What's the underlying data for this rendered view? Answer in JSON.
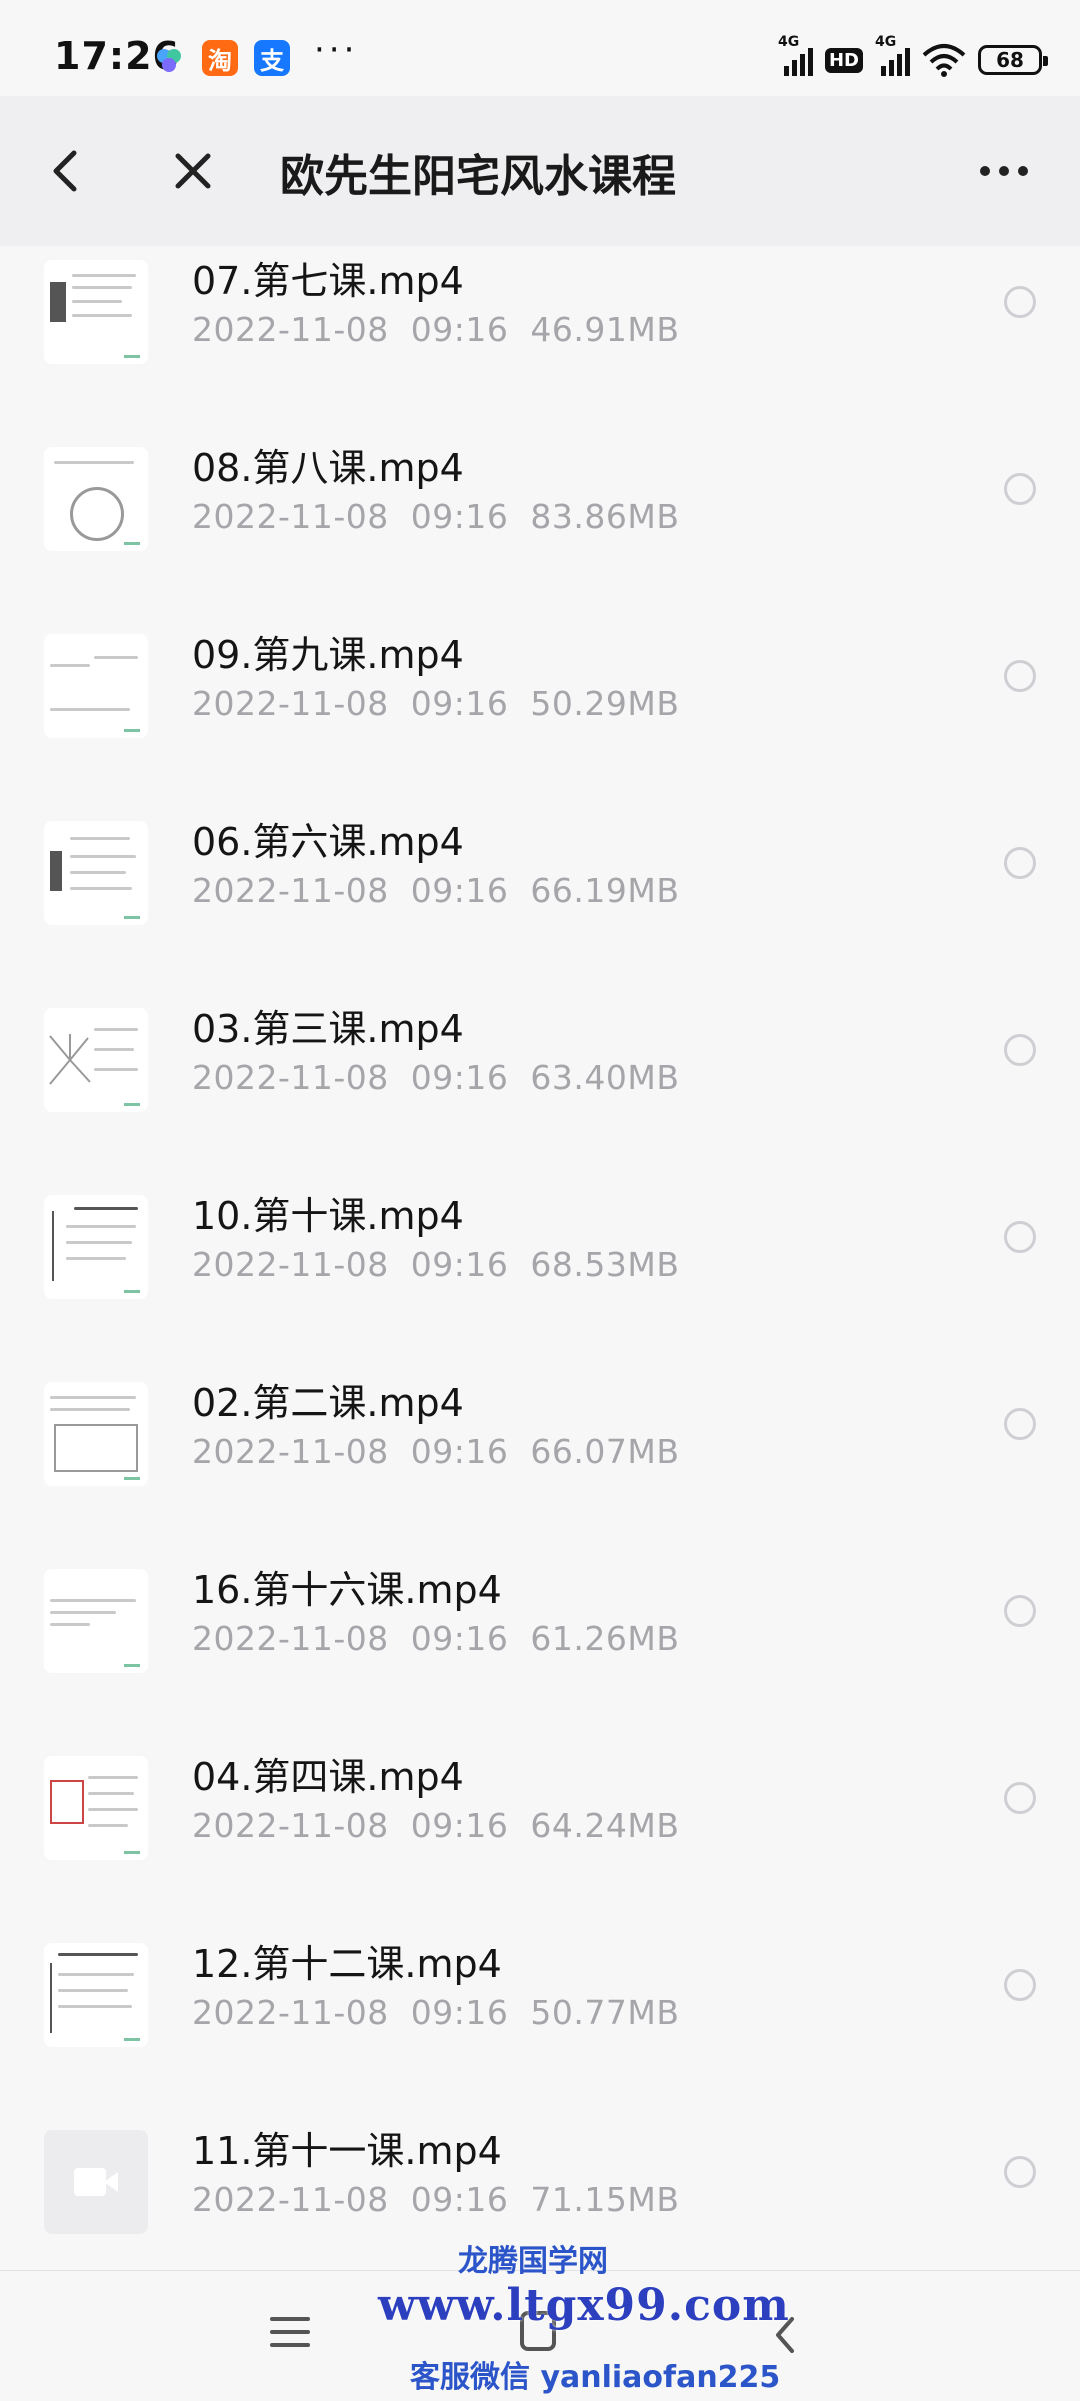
{
  "status_bar": {
    "time": "17:26",
    "icons": [
      "flower-app-icon",
      "taobao-icon",
      "alipay-icon"
    ],
    "tao_char": "淘",
    "pay_char": "支",
    "more": "···",
    "net1": "4G",
    "hd": "HD",
    "net2": "4G",
    "battery": "68"
  },
  "header": {
    "title": "欧先生阳宅风水课程"
  },
  "files": [
    {
      "name": "07.第七课.mp4",
      "date": "2022-11-08",
      "time": "09:16",
      "size": "46.91MB"
    },
    {
      "name": "08.第八课.mp4",
      "date": "2022-11-08",
      "time": "09:16",
      "size": "83.86MB"
    },
    {
      "name": "09.第九课.mp4",
      "date": "2022-11-08",
      "time": "09:16",
      "size": "50.29MB"
    },
    {
      "name": "06.第六课.mp4",
      "date": "2022-11-08",
      "time": "09:16",
      "size": "66.19MB"
    },
    {
      "name": "03.第三课.mp4",
      "date": "2022-11-08",
      "time": "09:16",
      "size": "63.40MB"
    },
    {
      "name": "10.第十课.mp4",
      "date": "2022-11-08",
      "time": "09:16",
      "size": "68.53MB"
    },
    {
      "name": "02.第二课.mp4",
      "date": "2022-11-08",
      "time": "09:16",
      "size": "66.07MB"
    },
    {
      "name": "16.第十六课.mp4",
      "date": "2022-11-08",
      "time": "09:16",
      "size": "61.26MB"
    },
    {
      "name": "04.第四课.mp4",
      "date": "2022-11-08",
      "time": "09:16",
      "size": "64.24MB"
    },
    {
      "name": "12.第十二课.mp4",
      "date": "2022-11-08",
      "time": "09:16",
      "size": "50.77MB"
    },
    {
      "name": "11.第十一课.mp4",
      "date": "2022-11-08",
      "time": "09:16",
      "size": "71.15MB"
    }
  ],
  "watermark": {
    "line1": "龙腾国学网",
    "line2": "www.ltgx99.com",
    "line3": "客服微信 yanliaofan225"
  },
  "colors": {
    "header_bg": "#efeff1",
    "meta_text": "#a6a6aa",
    "watermark": "#2c3fbf"
  }
}
